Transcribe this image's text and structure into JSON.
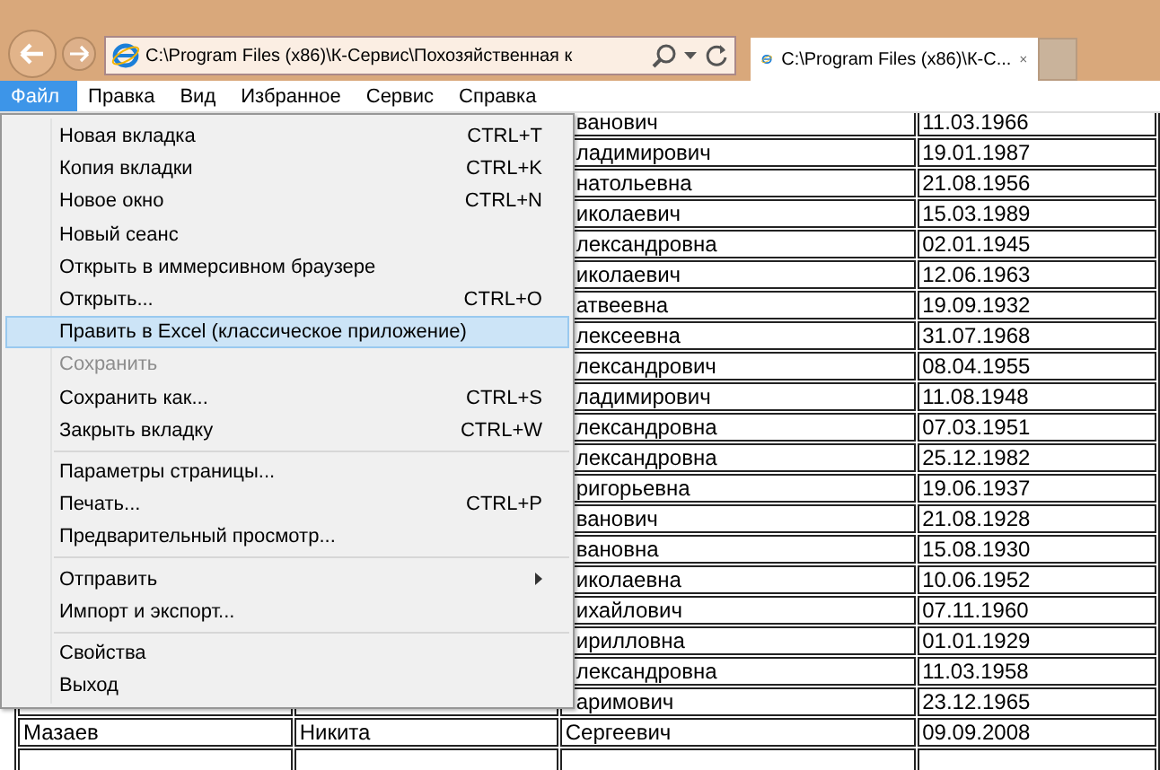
{
  "browser": {
    "address": "C:\\Program Files (x86)\\К-Сервис\\Похозяйственная к",
    "tab_title": "C:\\Program Files (x86)\\К-С..."
  },
  "menu_bar": [
    {
      "label": "Файл",
      "selected": true
    },
    {
      "label": "Правка",
      "selected": false
    },
    {
      "label": "Вид",
      "selected": false
    },
    {
      "label": "Избранное",
      "selected": false
    },
    {
      "label": "Сервис",
      "selected": false
    },
    {
      "label": "Справка",
      "selected": false
    }
  ],
  "file_menu": [
    {
      "kind": "item",
      "label": "Новая вкладка",
      "shortcut": "CTRL+T",
      "selected": false,
      "disabled": false
    },
    {
      "kind": "item",
      "label": "Копия вкладки",
      "shortcut": "CTRL+K",
      "selected": false,
      "disabled": false
    },
    {
      "kind": "item",
      "label": "Новое окно",
      "shortcut": "CTRL+N",
      "selected": false,
      "disabled": false
    },
    {
      "kind": "item",
      "label": "Новый сеанс",
      "selected": false,
      "disabled": false
    },
    {
      "kind": "item",
      "label": "Открыть в иммерсивном браузере",
      "selected": false,
      "disabled": false
    },
    {
      "kind": "item",
      "label": "Открыть...",
      "shortcut": "CTRL+O",
      "selected": false,
      "disabled": false
    },
    {
      "kind": "item",
      "label": "Править в Excel (классическое приложение)",
      "selected": true,
      "disabled": false
    },
    {
      "kind": "item",
      "label": "Сохранить",
      "selected": false,
      "disabled": true
    },
    {
      "kind": "item",
      "label": "Сохранить как...",
      "shortcut": "CTRL+S",
      "selected": false,
      "disabled": false
    },
    {
      "kind": "item",
      "label": "Закрыть вкладку",
      "shortcut": "CTRL+W",
      "selected": false,
      "disabled": false
    },
    {
      "kind": "separator"
    },
    {
      "kind": "item",
      "label": "Параметры страницы...",
      "selected": false,
      "disabled": false
    },
    {
      "kind": "item",
      "label": "Печать...",
      "shortcut": "CTRL+P",
      "selected": false,
      "disabled": false
    },
    {
      "kind": "item",
      "label": "Предварительный просмотр...",
      "selected": false,
      "disabled": false
    },
    {
      "kind": "separator"
    },
    {
      "kind": "submenu",
      "label": "Отправить",
      "selected": false,
      "disabled": false
    },
    {
      "kind": "item",
      "label": "Импорт и экспорт...",
      "selected": false,
      "disabled": false
    },
    {
      "kind": "separator"
    },
    {
      "kind": "item",
      "label": "Свойства",
      "selected": false,
      "disabled": false
    },
    {
      "kind": "item",
      "label": "Выход",
      "selected": false,
      "disabled": false
    }
  ],
  "table": {
    "rows": [
      {
        "column_3": "ванович",
        "column_4": "11.03.1966"
      },
      {
        "column_3": "ладимирович",
        "column_4": "19.01.1987"
      },
      {
        "column_3": "натольевна",
        "column_4": "21.08.1956"
      },
      {
        "column_3": "иколаевич",
        "column_4": "15.03.1989"
      },
      {
        "column_3": "лександровна",
        "column_4": "02.01.1945"
      },
      {
        "column_3": "иколаевич",
        "column_4": "12.06.1963"
      },
      {
        "column_3": "атвеевна",
        "column_4": "19.09.1932"
      },
      {
        "column_3": "лексеевна",
        "column_4": "31.07.1968"
      },
      {
        "column_3": "лександрович",
        "column_4": "08.04.1955"
      },
      {
        "column_3": "ладимирович",
        "column_4": "11.08.1948"
      },
      {
        "column_3": "лександровна",
        "column_4": "07.03.1951"
      },
      {
        "column_3": "лександровна",
        "column_4": "25.12.1982"
      },
      {
        "column_3": "ригорьевна",
        "column_4": "19.06.1937"
      },
      {
        "column_3": "ванович",
        "column_4": "21.08.1928"
      },
      {
        "column_3": "вановна",
        "column_4": "15.08.1930"
      },
      {
        "column_3": "иколаевна",
        "column_4": "10.06.1952"
      },
      {
        "column_3": "ихайлович",
        "column_4": "07.11.1960"
      },
      {
        "column_3": "ирилловна",
        "column_4": "01.01.1929"
      },
      {
        "column_3": "лександровна",
        "column_4": "11.03.1958"
      },
      {
        "column_3": "аримович",
        "column_4": "23.12.1965"
      },
      {
        "column_1": "Мазаев",
        "column_2": "Никита",
        "column_3": "Сергеевич",
        "column_4": "09.09.2008"
      }
    ]
  }
}
